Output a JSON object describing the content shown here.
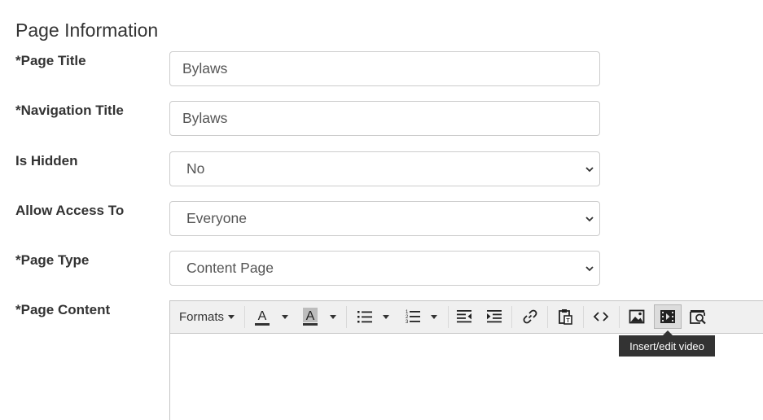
{
  "section": {
    "title": "Page Information"
  },
  "form": {
    "page_title": {
      "label": "*Page Title",
      "value": "Bylaws"
    },
    "navigation_title": {
      "label": "*Navigation Title",
      "value": "Bylaws"
    },
    "is_hidden": {
      "label": "Is Hidden",
      "selected": "No"
    },
    "allow_access": {
      "label": "Allow Access To",
      "selected": "Everyone"
    },
    "page_type": {
      "label": "*Page Type",
      "selected": "Content Page"
    },
    "page_content": {
      "label": "*Page Content"
    }
  },
  "editor": {
    "formats_label": "Formats",
    "text_color_glyph": "A",
    "background_color_glyph": "A",
    "text_color_bar": "#333333",
    "background_color_bar": "#333333",
    "icons": [
      "text-color-icon",
      "background-color-icon",
      "bullet-list-icon",
      "numbered-list-icon",
      "outdent-icon",
      "indent-icon",
      "link-icon",
      "paste-icon",
      "source-code-icon",
      "image-icon",
      "video-icon",
      "preview-icon"
    ],
    "active_button": "video-icon",
    "tooltip": "Insert/edit video"
  }
}
